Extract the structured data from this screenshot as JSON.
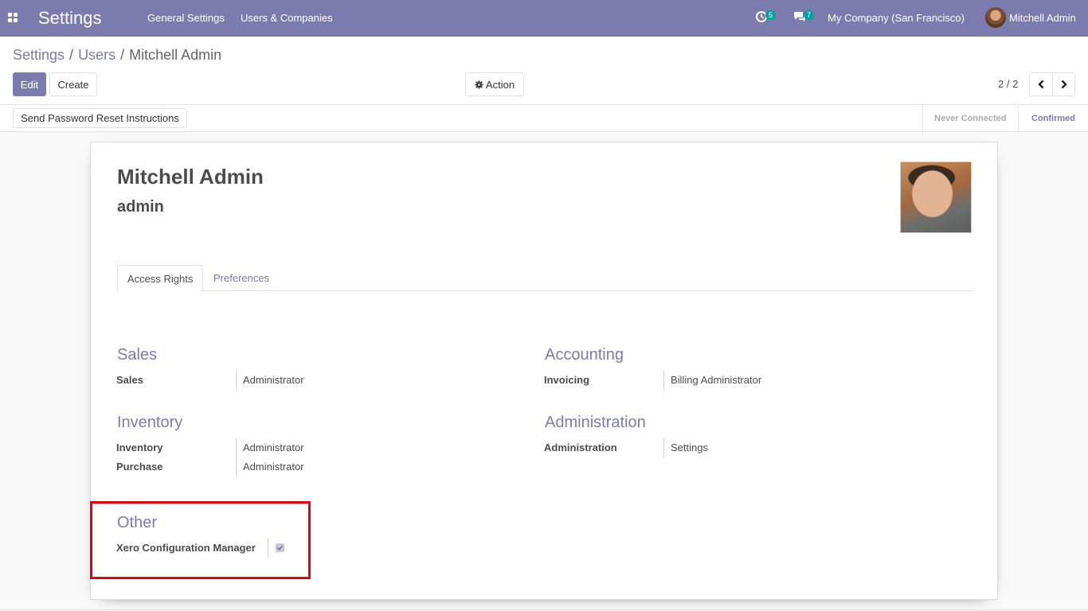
{
  "navbar": {
    "app_title": "Settings",
    "menu": [
      "General Settings",
      "Users & Companies"
    ],
    "activity_count": "5",
    "messages_count": "7",
    "company": "My Company (San Francisco)",
    "user": "Mitchell Admin",
    "brand_color": "#7c7bad"
  },
  "breadcrumb": {
    "items": [
      "Settings",
      "Users"
    ],
    "current": "Mitchell Admin",
    "separator": "/"
  },
  "buttons": {
    "edit": "Edit",
    "create": "Create",
    "action": "Action"
  },
  "pager": {
    "value": "2 / 2"
  },
  "statusbar": {
    "reset_button": "Send Password Reset Instructions",
    "stages": [
      "Never Connected",
      "Confirmed"
    ],
    "active_stage": "Confirmed"
  },
  "form": {
    "name": "Mitchell Admin",
    "login": "admin",
    "tabs": [
      "Access Rights",
      "Preferences"
    ],
    "active_tab": "Access Rights",
    "groups": {
      "sales": {
        "title": "Sales",
        "fields": [
          {
            "label": "Sales",
            "value": "Administrator"
          }
        ]
      },
      "accounting": {
        "title": "Accounting",
        "fields": [
          {
            "label": "Invoicing",
            "value": "Billing Administrator"
          }
        ]
      },
      "inventory": {
        "title": "Inventory",
        "fields": [
          {
            "label": "Inventory",
            "value": "Administrator"
          },
          {
            "label": "Purchase",
            "value": "Administrator"
          }
        ]
      },
      "administration": {
        "title": "Administration",
        "fields": [
          {
            "label": "Administration",
            "value": "Settings"
          }
        ]
      },
      "other": {
        "title": "Other",
        "fields": [
          {
            "label": "Xero Configuration Manager",
            "checked": true
          }
        ]
      }
    }
  },
  "highlight_color": "#e0000f"
}
